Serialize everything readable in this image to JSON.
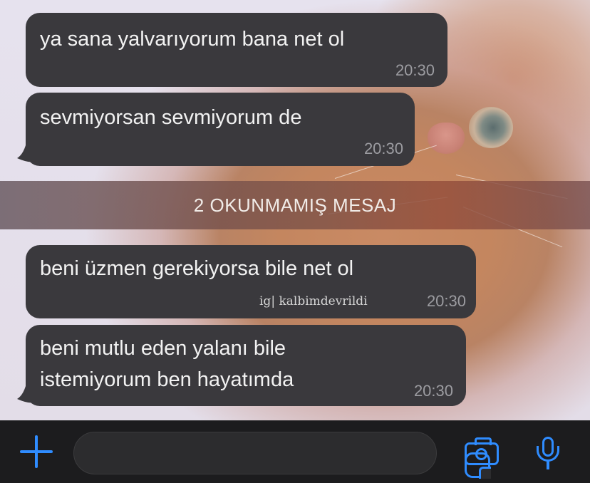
{
  "chat": {
    "messages": [
      {
        "text": "ya sana yalvarıyorum bana net ol",
        "time": "20:30"
      },
      {
        "text": "sevmiyorsan sevmiyorum de",
        "time": "20:30"
      },
      {
        "text": "beni üzmen gerekiyorsa bile net ol",
        "time": "20:30",
        "watermark": "ig| kalbimdevrildi"
      },
      {
        "text_lines": [
          "beni mutlu eden yalanı bile",
          "istemiyorum ben hayatımda"
        ],
        "time": "20:30"
      }
    ],
    "unread_divider": "2 OKUNMAMIŞ MESAJ"
  },
  "composer": {
    "placeholder": "",
    "icons": [
      "plus-icon",
      "sticker-icon",
      "camera-icon",
      "microphone-icon"
    ],
    "accent": "#2f8cff"
  },
  "colors": {
    "bubble": "#3a393d",
    "time": "#9c9ca1",
    "bar": "#1c1c1e"
  }
}
